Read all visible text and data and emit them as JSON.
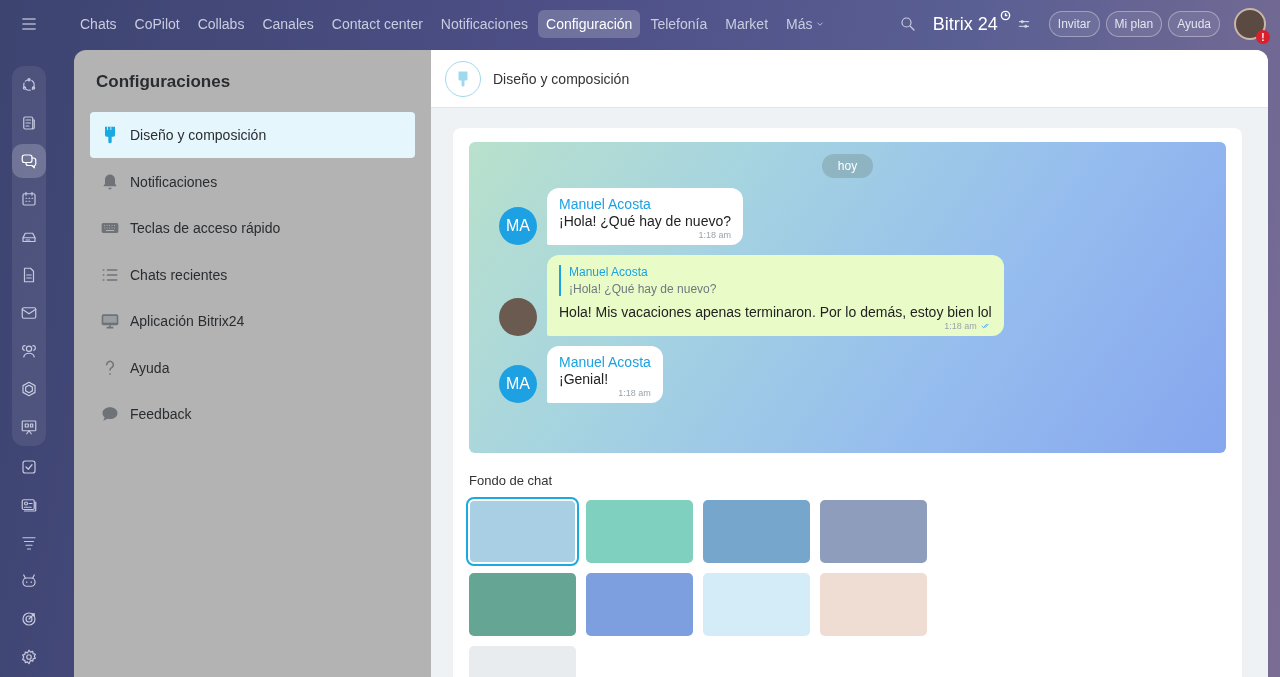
{
  "top_nav": {
    "items": [
      {
        "label": "Chats",
        "selected": false
      },
      {
        "label": "CoPilot",
        "selected": false
      },
      {
        "label": "Collabs",
        "selected": false
      },
      {
        "label": "Canales",
        "selected": false
      },
      {
        "label": "Contact center",
        "selected": false
      },
      {
        "label": "Notificaciones",
        "selected": false
      },
      {
        "label": "Configuración",
        "selected": true
      },
      {
        "label": "Telefonía",
        "selected": false
      },
      {
        "label": "Market",
        "selected": false
      },
      {
        "label": "Más",
        "selected": false,
        "kind": "dropdown"
      }
    ],
    "brand": "Bitrix 24",
    "buttons": [
      "Invitar",
      "Mi plan",
      "Ayuda"
    ],
    "alert_badge": "!"
  },
  "rail": {
    "items": [
      {
        "kind": "copilot",
        "selected": false
      },
      {
        "kind": "feed",
        "selected": false
      },
      {
        "kind": "chat",
        "selected": true
      },
      {
        "kind": "calendar",
        "selected": false
      },
      {
        "kind": "drive",
        "selected": false
      },
      {
        "kind": "document",
        "selected": false
      },
      {
        "kind": "mail",
        "selected": false
      },
      {
        "kind": "people",
        "selected": false
      },
      {
        "kind": "hexagon",
        "selected": false
      },
      {
        "kind": "board",
        "selected": false
      },
      {
        "kind": "task",
        "selected": false
      },
      {
        "kind": "card",
        "selected": false
      },
      {
        "kind": "funnel",
        "selected": false
      },
      {
        "kind": "robot",
        "selected": false
      },
      {
        "kind": "target",
        "selected": false
      },
      {
        "kind": "gear",
        "selected": false
      }
    ]
  },
  "settings_menu": {
    "title": "Configuraciones",
    "items": [
      {
        "label": "Diseño y composición",
        "kind": "brush",
        "selected": true
      },
      {
        "label": "Notificaciones",
        "kind": "bell",
        "selected": false
      },
      {
        "label": "Teclas de acceso rápido",
        "kind": "keyboard",
        "selected": false
      },
      {
        "label": "Chats recientes",
        "kind": "list",
        "selected": false
      },
      {
        "label": "Aplicación Bitrix24",
        "kind": "monitor",
        "selected": false
      },
      {
        "label": "Ayuda",
        "kind": "question",
        "selected": false
      },
      {
        "label": "Feedback",
        "kind": "bubble",
        "selected": false
      }
    ]
  },
  "panel": {
    "title": "Diseño y composición",
    "chat_preview": {
      "date": "hoy",
      "messages": [
        {
          "kind": "incoming",
          "avatar": "MA",
          "author": "Manuel Acosta",
          "text": "¡Hola! ¿Qué hay de nuevo?",
          "time": "1:18 am"
        },
        {
          "kind": "outgoing",
          "quote_author": "Manuel Acosta",
          "quote_text": "¡Hola! ¿Qué hay de nuevo?",
          "text": "Hola! Mis vacaciones apenas terminaron. Por lo demás, estoy bien lol",
          "time": "1:18 am",
          "read": true
        },
        {
          "kind": "incoming",
          "avatar": "MA",
          "author": "Manuel Acosta",
          "text": "¡Genial!",
          "time": "1:18 am"
        }
      ]
    },
    "background_label": "Fondo de chat",
    "backgrounds": [
      {
        "color": "#a9cfe4",
        "selected": true
      },
      {
        "color": "#7fd0bf",
        "selected": false
      },
      {
        "color": "#76a6cc",
        "selected": false
      },
      {
        "color": "#8f9dbd",
        "selected": false
      },
      {
        "color": "#64a594",
        "selected": false
      },
      {
        "color": "#7e9fdf",
        "selected": false
      },
      {
        "color": "#d3ecf7",
        "selected": false
      },
      {
        "color": "#efdcd3",
        "selected": false
      },
      {
        "color": "#e8ecef",
        "selected": false
      }
    ]
  }
}
